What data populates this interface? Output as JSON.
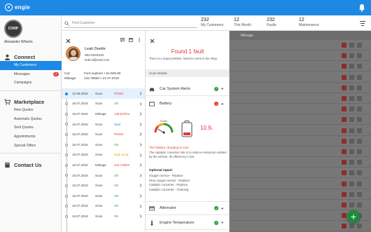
{
  "app": {
    "logo_letter": "e",
    "logo_text": "engie"
  },
  "sidebar": {
    "avatar_text": "CORP",
    "username": "Alexander Wheels",
    "sections": [
      {
        "title": "Connect",
        "items": [
          {
            "label": "My Customers",
            "active": true
          },
          {
            "label": "Messages",
            "badge": "12"
          },
          {
            "label": "Campaigns"
          }
        ]
      },
      {
        "title": "Marketplace",
        "items": [
          {
            "label": "New Quotes"
          },
          {
            "label": "Automatic Quotes"
          },
          {
            "label": "Sent Quotes"
          },
          {
            "label": "Appointments"
          },
          {
            "label": "Special Offers"
          }
        ]
      },
      {
        "title": "Contact Us",
        "items": []
      }
    ]
  },
  "stats": {
    "search_placeholder": "Find Customer",
    "items": [
      {
        "num": "232",
        "label": "My Customers"
      },
      {
        "num": "12",
        "label": "This Month"
      },
      {
        "num": "232",
        "label": "Faults"
      },
      {
        "num": "12",
        "label": "Maintenance"
      }
    ]
  },
  "background_table": {
    "col_mileage": "Mileage"
  },
  "customer": {
    "name": "Leah Deetle",
    "phone": "052-8333333",
    "email": "leah.d@mail.com",
    "car_label": "Car:",
    "car_value": "Ford explorer • 61-505-90",
    "mileage_label": "Mileage:",
    "mileage_value": "134,756km • 21.07.2018"
  },
  "scans": [
    {
      "date": "12.08.2018",
      "type": "Scan",
      "value": "P0420",
      "color": "#e53935",
      "active": true
    },
    {
      "date": "16.07.2018",
      "type": "Scan",
      "value": "OK",
      "color": "#2e9c3e"
    },
    {
      "date": "16.07.2018",
      "type": "Mileage",
      "value": "148,537km",
      "color": "#e53935"
    },
    {
      "date": "16.07.2018",
      "type": "Scan",
      "value": "Sent",
      "color": "#1e88e5"
    },
    {
      "date": "15.07.2018",
      "type": "Scan",
      "value": "P0420",
      "color": "#e53935"
    },
    {
      "date": "16.07.2018",
      "type": "Scan",
      "value": "OK",
      "color": "#2e9c3e"
    },
    {
      "date": "16.07.2018",
      "type": "Scan",
      "value": "High temp",
      "color": "#f0a500"
    },
    {
      "date": "16.07.2018",
      "type": "Mileage",
      "value": "142,734km",
      "color": "#e53935"
    },
    {
      "date": "16.07.2018",
      "type": "Scan",
      "value": "OK",
      "color": "#2e9c3e"
    },
    {
      "date": "16.07.2018",
      "type": "Scan",
      "value": "OK",
      "color": "#2e9c3e"
    },
    {
      "date": "16.07.2018",
      "type": "Scan",
      "value": "OK",
      "color": "#2e9c3e"
    },
    {
      "date": "16.07.2018",
      "type": "Scan",
      "value": "OK",
      "color": "#2e9c3e"
    },
    {
      "date": "16.07.2018",
      "type": "Scan",
      "value": "OK",
      "color": "#2e9c3e"
    }
  ],
  "detail": {
    "found_title": "Found 1 fault",
    "found_sub": "There is a major problem. Need to come to the shop.",
    "details_header": "Scan Details",
    "sections": [
      {
        "label": "Car System Alerts",
        "status": "ok"
      },
      {
        "label": "Battery",
        "status": "fault"
      }
    ],
    "voltage": "10.9",
    "voltage_unit": "v",
    "gauge_label": "Health",
    "warn_title": "The battery charging is Low",
    "warn_text": "The catalytic converter role is to reduce emissions emitted by the vehicle. Its efficiency is low.",
    "optional_title": "Optional repair:",
    "optional_items": [
      "Oxygen sensor - Replace",
      "Rear oxygen sensor - Replace",
      "Catalytic converter - Replace",
      "Catalytic converter - Cleaning"
    ],
    "bottom_sections": [
      {
        "label": "Alternator",
        "status": "ok"
      },
      {
        "label": "Engine Temperature",
        "status": "ok"
      }
    ]
  },
  "colors": {
    "primary": "#1e88e5",
    "danger": "#e53935",
    "ok": "#2e9c3e",
    "fab": "#1b8a3c"
  }
}
